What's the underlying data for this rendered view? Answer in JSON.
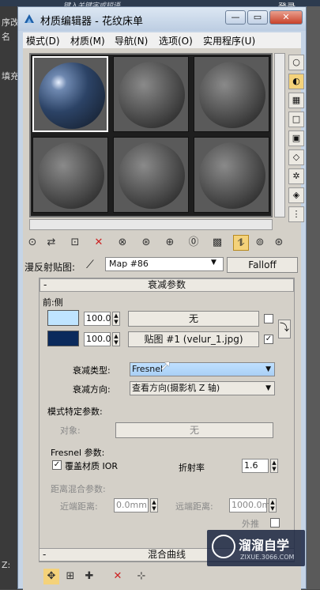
{
  "host": {
    "login": "登录",
    "key_hint": "键入关键字或短语",
    "left_labels": [
      "序改名",
      "填充",
      "Z:"
    ]
  },
  "window": {
    "title": "材质编辑器 - 花纹床单",
    "buttons": {
      "minimize": "—",
      "restore": "▭",
      "close": "✕"
    }
  },
  "menu": [
    "模式(D)",
    "材质(M)",
    "导航(N)",
    "选项(O)",
    "实用程序(U)"
  ],
  "map_row": {
    "label": "漫反射贴图:",
    "map_name": "Map #86",
    "map_type": "Falloff"
  },
  "falloff_rollout": {
    "title": "衰减参数",
    "front_side": "前:侧",
    "row1": {
      "value": "100.0",
      "button": "无"
    },
    "row2": {
      "value": "100.0",
      "button": "贴图 #1 (velur_1.jpg)"
    },
    "falloff_type_label": "衰减类型:",
    "falloff_type_value": "Fresnel",
    "falloff_dir_label": "衰减方向:",
    "falloff_dir_value": "查看方向(摄影机 Z 轴)"
  },
  "mode_params": {
    "title": "模式特定参数:",
    "object_label": "对象:",
    "object_button": "无",
    "fresnel_title": "Fresnel 参数:",
    "override_ior": "覆盖材质 IOR",
    "ior_label": "折射率",
    "ior_value": "1.6",
    "distance_title": "距离混合参数:",
    "near_label": "近端距离:",
    "near_value": "0.0mm",
    "far_label": "远端距离:",
    "far_value": "1000.0m",
    "extrapolate": "外推"
  },
  "blend_rollout": {
    "title": "混合曲线"
  },
  "watermark": {
    "name": "溜溜自学",
    "url": "ZIXUE.3066.COM"
  },
  "colors": {
    "front_swatch": "#bfe4ff",
    "side_swatch": "#0b2a5c",
    "highlight_box": "#e02020"
  }
}
